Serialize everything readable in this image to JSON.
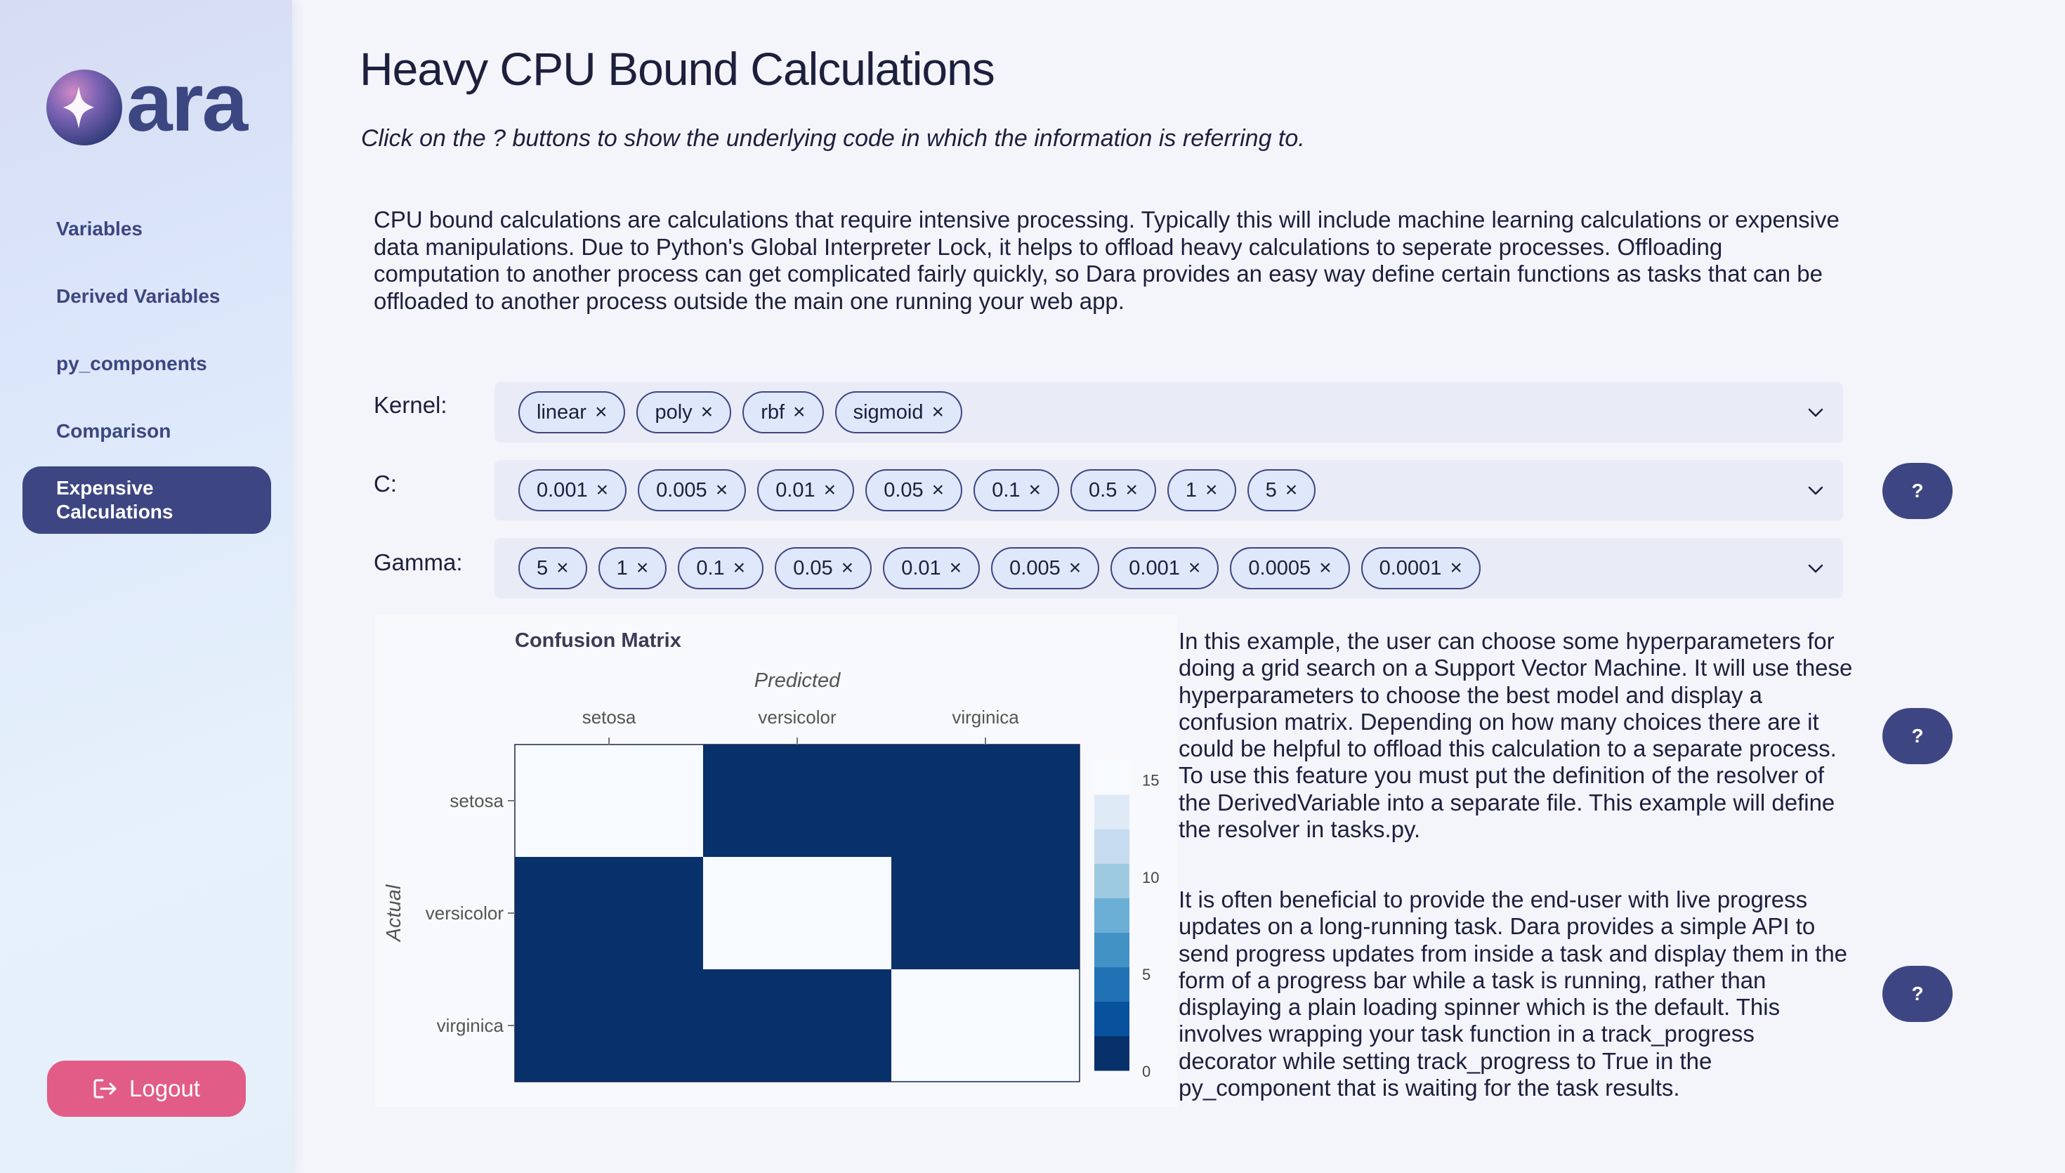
{
  "app": {
    "brand": "ara"
  },
  "sidebar": {
    "items": [
      {
        "label": "Variables"
      },
      {
        "label": "Derived Variables"
      },
      {
        "label": "py_components"
      },
      {
        "label": "Comparison"
      },
      {
        "label": "Expensive Calculations",
        "active": true
      }
    ],
    "logout_label": "Logout"
  },
  "main": {
    "title": "Heavy CPU Bound Calculations",
    "subtitle": "Click on the ? buttons to show the underlying code in which the information is referring to.",
    "intro": "CPU bound calculations are calculations that require intensive processing. Typically this will include machine learning calculations or expensive data manipulations. Due to Python's Global Interpreter Lock, it helps to offload heavy calculations to seperate processes. Offloading computation to another process can get complicated fairly quickly, so Dara provides an easy way define certain functions as tasks that can be offloaded to another process outside the main one running your web app.",
    "filters": {
      "kernel": {
        "label": "Kernel:",
        "values": [
          "linear",
          "poly",
          "rbf",
          "sigmoid"
        ]
      },
      "c": {
        "label": "C:",
        "values": [
          "0.001",
          "0.005",
          "0.01",
          "0.05",
          "0.1",
          "0.5",
          "1",
          "5"
        ]
      },
      "gamma": {
        "label": "Gamma:",
        "values": [
          "5",
          "1",
          "0.1",
          "0.05",
          "0.01",
          "0.005",
          "0.001",
          "0.0005",
          "0.0001"
        ]
      }
    },
    "help_label": "?",
    "chip_remove": "×",
    "para1": "In this example, the user can choose some hyperparameters for doing a grid search on a Support Vector Machine. It will use these hyperparameters to choose the best model and display a confusion matrix. Depending on how many choices there are it could be helpful to offload this calculation to a separate process. To use this feature you must put the definition of the resolver of the DerivedVariable into a separate file. This example will define the resolver in tasks.py.",
    "para2": "It is often beneficial to provide the end-user with live progress updates on a long-running task. Dara provides a simple API to send progress updates from inside a task and display them in the form of a progress bar while a task is running, rather than displaying a plain loading spinner which is the default. This involves wrapping your task function in a track_progress decorator while setting track_progress to True in the py_component that is waiting for the task results."
  },
  "colors": {
    "accent": "#3d4682",
    "logout": "#e15c86",
    "chip_bg": "#dfe8fb"
  },
  "icons": {
    "logo": "dara-logo-icon",
    "logout": "logout-icon",
    "chevron": "chevron-down-icon",
    "remove": "close-icon"
  },
  "chart_data": {
    "type": "heatmap",
    "title": "Confusion Matrix",
    "xlabel": "Predicted",
    "ylabel": "Actual",
    "x_categories": [
      "setosa",
      "versicolor",
      "virginica"
    ],
    "y_categories": [
      "setosa",
      "versicolor",
      "virginica"
    ],
    "values": [
      [
        15,
        0,
        0
      ],
      [
        0,
        16,
        0
      ],
      [
        0,
        0,
        15
      ]
    ],
    "colorscale_range": [
      0,
      16
    ],
    "colorbar_ticks": [
      "0",
      "5",
      "10",
      "15"
    ],
    "colorbar_tick_values": [
      0,
      5,
      10,
      15
    ],
    "colorscale": [
      "#08306b",
      "#08519c",
      "#2171b5",
      "#4292c6",
      "#6baed6",
      "#9ecae1",
      "#c6dbef",
      "#deebf7",
      "#f7fbff"
    ]
  }
}
